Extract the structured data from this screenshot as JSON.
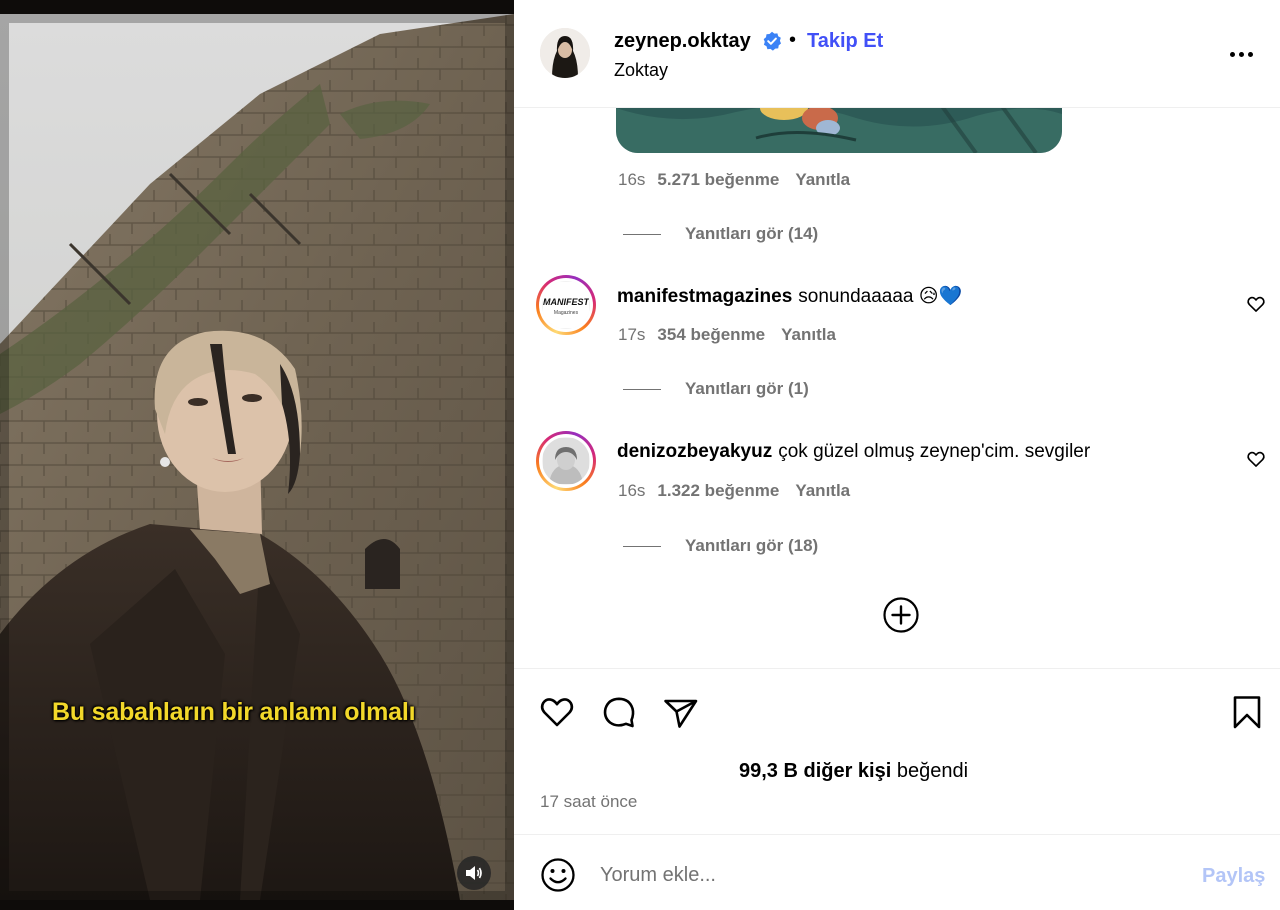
{
  "video": {
    "caption": "Bu sabahların bir anlamı olmalı",
    "mute_icon": "speaker-icon"
  },
  "header": {
    "username": "zeynep.okktay",
    "verified": true,
    "separator": "•",
    "follow_label": "Takip Et",
    "subtitle": "Zoktay",
    "more_icon": "more-options-icon"
  },
  "comments": [
    {
      "time": "16s",
      "likes": "5.271 beğenme",
      "reply": "Yanıtla",
      "view_replies": "Yanıtları gör (14)"
    },
    {
      "username": "manifestmagazines",
      "text": "sonundaaaaa",
      "emoji": "😥💙",
      "avatar_text": "MANIFEST",
      "avatar_sub": "Magazines",
      "time": "17s",
      "likes": "354 beğenme",
      "reply": "Yanıtla",
      "view_replies": "Yanıtları gör (1)"
    },
    {
      "username": "denizozbeyakyuz",
      "text": "çok güzel olmuş zeynep'cim. sevgiler",
      "time": "16s",
      "likes": "1.322 beğenme",
      "reply": "Yanıtla",
      "view_replies": "Yanıtları gör (18)"
    }
  ],
  "likes": {
    "count": "99,3 B diğer kişi",
    "suffix": "beğendi"
  },
  "posted": "17 saat önce",
  "composer": {
    "placeholder": "Yorum ekle...",
    "share_label": "Paylaş"
  },
  "colors": {
    "accent": "#4150f7",
    "muted": "#737373",
    "caption": "#f2d82a",
    "share_disabled": "#b3c5f7"
  }
}
